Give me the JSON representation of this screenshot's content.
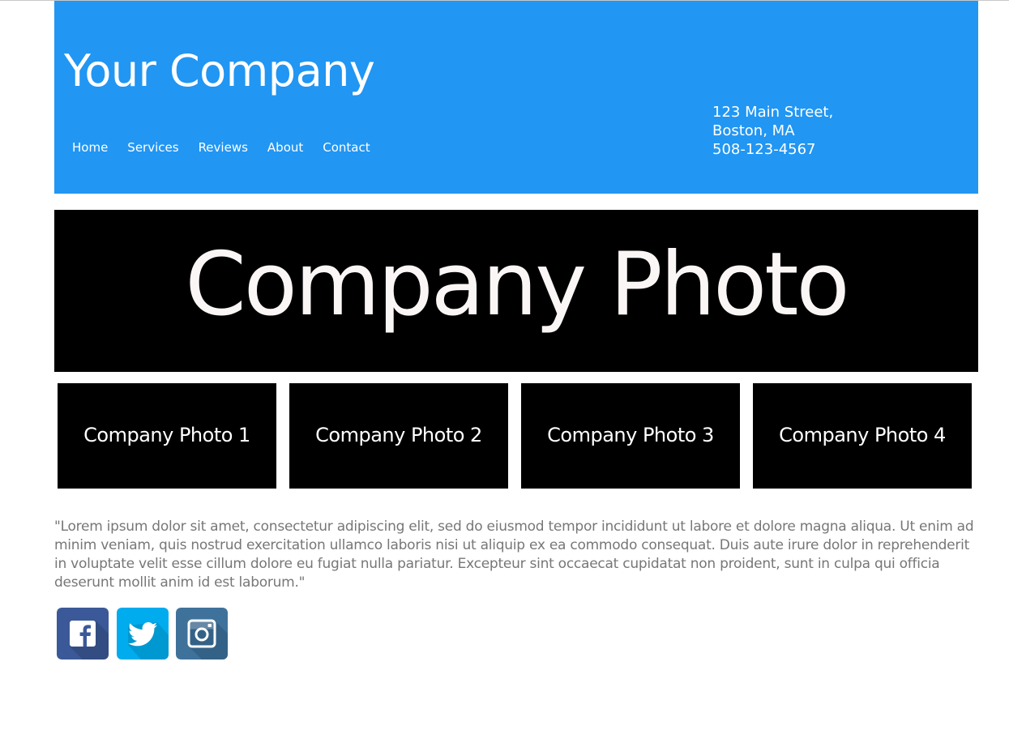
{
  "header": {
    "company_name": "Your Company",
    "nav": [
      {
        "label": "Home"
      },
      {
        "label": "Services"
      },
      {
        "label": "Reviews"
      },
      {
        "label": "About"
      },
      {
        "label": "Contact"
      }
    ],
    "address": {
      "street": "123 Main Street,",
      "city": "Boston, MA",
      "phone": "508-123-4567"
    }
  },
  "hero": {
    "label": "Company Photo"
  },
  "thumbnails": [
    {
      "label": "Company Photo 1"
    },
    {
      "label": "Company Photo 2"
    },
    {
      "label": "Company Photo 3"
    },
    {
      "label": "Company Photo 4"
    }
  ],
  "quote": "\"Lorem ipsum dolor sit amet, consectetur adipiscing elit, sed do eiusmod tempor incididunt ut labore et dolore magna aliqua. Ut enim ad minim veniam, quis nostrud exercitation ullamco laboris nisi ut aliquip ex ea commodo consequat. Duis aute irure dolor in reprehenderit in voluptate velit esse cillum dolore eu fugiat nulla pariatur. Excepteur sint occaecat cupidatat non proident, sunt in culpa qui officia deserunt mollit anim id est laborum.\"",
  "social": [
    {
      "icon": "facebook-icon",
      "color": "#3B5998"
    },
    {
      "icon": "twitter-icon",
      "color": "#00ACED"
    },
    {
      "icon": "instagram-icon",
      "color": "#3F729B"
    }
  ],
  "colors": {
    "header_bg": "#2196F3",
    "photo_bg": "#000000",
    "body_text": "#777777"
  }
}
